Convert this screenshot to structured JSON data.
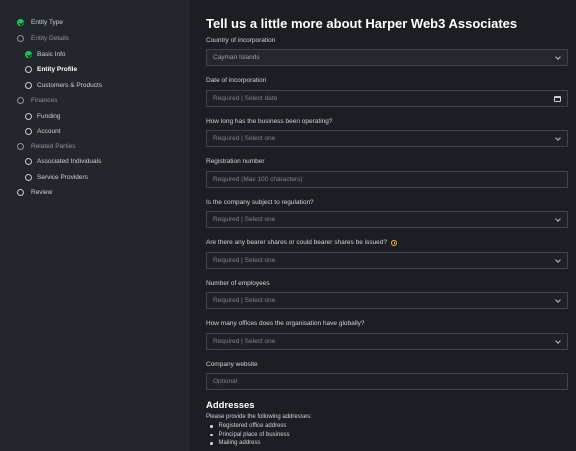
{
  "sidebar": {
    "items": [
      {
        "label": "Entity Type",
        "state": "done"
      },
      {
        "label": "Entity Details",
        "state": "muted"
      },
      {
        "label": "Basic Info",
        "state": "done"
      },
      {
        "label": "Entity Profile",
        "state": "active"
      },
      {
        "label": "Customers & Products",
        "state": "pending"
      },
      {
        "label": "Finances",
        "state": "muted"
      },
      {
        "label": "Funding",
        "state": "pending"
      },
      {
        "label": "Account",
        "state": "pending"
      },
      {
        "label": "Related Parties",
        "state": "muted"
      },
      {
        "label": "Associated Individuals",
        "state": "pending"
      },
      {
        "label": "Service Providers",
        "state": "pending"
      },
      {
        "label": "Review",
        "state": "pending"
      }
    ]
  },
  "main": {
    "title": "Tell us a little more about Harper Web3 Associates",
    "fields": [
      {
        "label": "Country of incorporation",
        "value": "Cayman Islands",
        "placeholder": "",
        "icon": "chevron-down-icon"
      },
      {
        "label": "Date of incorporation",
        "value": "",
        "placeholder": "Required | Select date",
        "icon": "calendar-icon"
      },
      {
        "label": "How long has the business been operating?",
        "value": "",
        "placeholder": "Required | Select one",
        "icon": "chevron-down-icon"
      },
      {
        "label": "Registration number",
        "value": "",
        "placeholder": "Required (Max 100 characters)",
        "icon": ""
      },
      {
        "label": "Is the company subject to regulation?",
        "value": "",
        "placeholder": "Required | Select one",
        "icon": "chevron-down-icon"
      },
      {
        "label": "Are there any bearer shares or could bearer shares be issued?",
        "value": "",
        "placeholder": "Required | Select one",
        "icon": "chevron-down-icon"
      },
      {
        "label": "Number of employees",
        "value": "",
        "placeholder": "Required | Select one",
        "icon": "chevron-down-icon"
      },
      {
        "label": "How many offices does the organisation have globally?",
        "value": "",
        "placeholder": "Required | Select one",
        "icon": "chevron-down-icon"
      },
      {
        "label": "Company website",
        "value": "",
        "placeholder": "Optional",
        "icon": ""
      }
    ],
    "addresses": {
      "heading": "Addresses",
      "description": "Please provide the following addresses:",
      "items": [
        "Registered office address",
        "Principal place of business",
        "Mailing address"
      ]
    }
  },
  "colors": {
    "accent": "#22c25a",
    "info": "#f2b544",
    "sidebar_bg": "#23272b",
    "main_bg": "#1b1e22"
  }
}
